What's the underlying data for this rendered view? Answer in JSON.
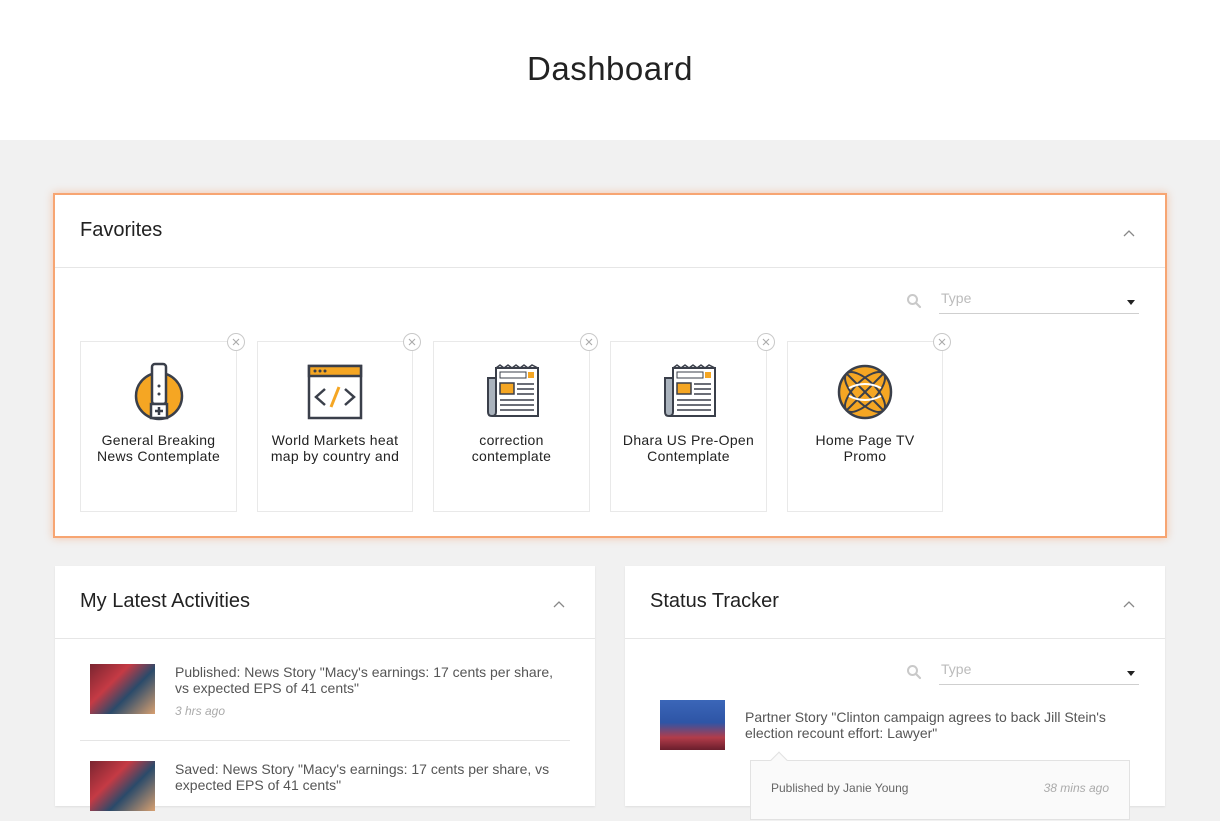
{
  "page": {
    "title": "Dashboard"
  },
  "favorites": {
    "title": "Favorites",
    "filter": {
      "placeholder": "Type"
    },
    "items": [
      {
        "name": "General Breaking News Contemplate",
        "icon": "breaking-news-icon"
      },
      {
        "name": "World Markets heat map by country and",
        "icon": "code-window-icon"
      },
      {
        "name": "correction contemplate",
        "icon": "newspaper-icon"
      },
      {
        "name": "Dhara US Pre-Open Contemplate",
        "icon": "newspaper-icon"
      },
      {
        "name": "Home Page TV Promo",
        "icon": "globe-icon"
      }
    ]
  },
  "activities": {
    "title": "My Latest Activities",
    "items": [
      {
        "text": "Published: News Story \"Macy's earnings: 17 cents per share, vs expected EPS of 41 cents\"",
        "time": "3 hrs ago"
      },
      {
        "text": "Saved: News Story \"Macy's earnings: 17 cents per share, vs expected EPS of 41 cents\""
      }
    ]
  },
  "status": {
    "title": "Status Tracker",
    "filter": {
      "placeholder": "Type"
    },
    "item": {
      "text": "Partner Story \"Clinton campaign agrees to back Jill Stein's election recount effort: Lawyer\"",
      "published_by": "Published by Janie Young",
      "time": "38 mins ago"
    }
  },
  "colors": {
    "accent_border": "#f7a572",
    "icon_orange": "#f5a623",
    "icon_dark": "#3a3f4a"
  }
}
